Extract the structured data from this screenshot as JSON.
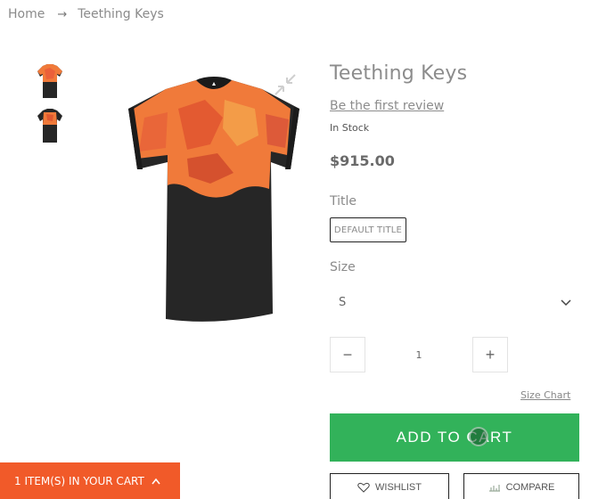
{
  "breadcrumb": {
    "home": "Home",
    "separator": "→",
    "current": "Teething Keys"
  },
  "product": {
    "title": "Teething Keys",
    "review_link": "Be the first review",
    "stock": "In Stock",
    "price": "$915.00",
    "image_alt": "Black and orange t-shirt"
  },
  "options": {
    "title_label": "Title",
    "title_value": "DEFAULT TITLE",
    "size_label": "Size",
    "size_value": "S"
  },
  "quantity": {
    "minus": "−",
    "value": "1",
    "plus": "+"
  },
  "links": {
    "size_chart": "Size Chart"
  },
  "actions": {
    "add_to_cart": "ADD TO CART",
    "wishlist": "WISHLIST",
    "compare": "COMPARE"
  },
  "cart_bar": {
    "label": "1 ITEM(S) IN YOUR CART"
  },
  "colors": {
    "add_to_cart": "#32b25a",
    "cart_bar": "#f15a29",
    "shirt_black": "#262626",
    "shirt_orange": "#f07a3a"
  },
  "icons": {
    "zoom": "shrink-arrows-icon",
    "chevron": "chevron-down-icon",
    "wishlist": "heart-icon",
    "compare": "compare-icon",
    "cart_bar_caret": "chevron-up-icon"
  }
}
